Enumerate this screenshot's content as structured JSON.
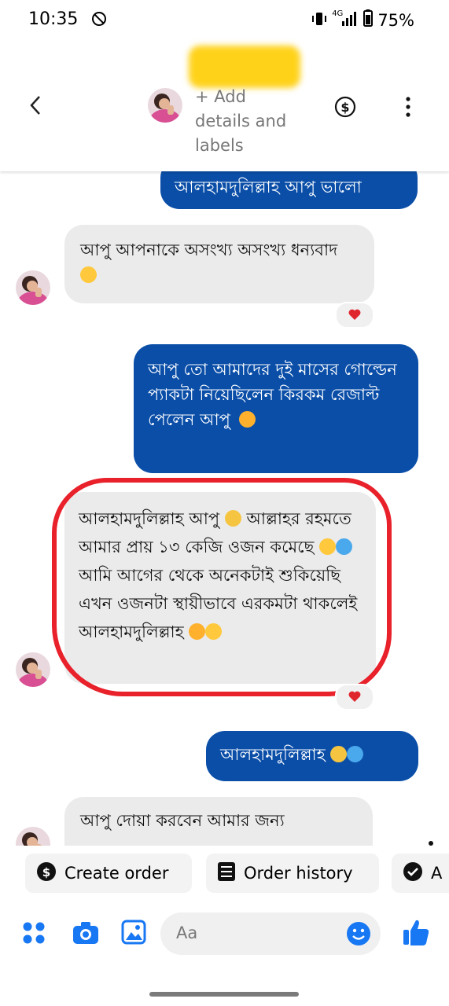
{
  "status_bar": {
    "time": "10:35",
    "network": "4G",
    "battery": "75%"
  },
  "header": {
    "details_text": "+ Add\ndetails and\nlabels",
    "icons": [
      "back-arrow-icon",
      "dollar-icon",
      "more-vert-icon"
    ]
  },
  "messages": [
    {
      "side": "out",
      "text": "আলহামদুলিল্লাহ আপু ভালো"
    },
    {
      "side": "in",
      "text": "আপু আপনাকে অসংখ্য অসংখ্য ধন্যবাদ",
      "emoji": [
        "blush"
      ],
      "reaction": "heart"
    },
    {
      "side": "out",
      "text": "আপু তো আমাদের দুই মাসের গোল্ডেন প্যাকটা নিয়েছিলেন কিরকম রেজাল্ট পেলেন আপু",
      "emoji": [
        "smiling-hearts"
      ]
    },
    {
      "side": "in",
      "text": "আলহামদুলিল্লাহ আপু",
      "text2": "আল্লাহর রহমতে আমার প্রায় ১৩ কেজি ওজন কমেছে",
      "text3": "আমি আগের থেকে অনেকটাই শুকিয়েছি এখন ওজনটা স্থায়ীভাবে এরকমটা থাকলেই আলহামদুলিল্লাহ",
      "highlighted": true,
      "reaction": "heart"
    },
    {
      "side": "out",
      "text": "আলহামদুলিল্লাহ",
      "emoji": [
        "raised-hands",
        "blue-heart"
      ]
    },
    {
      "side": "in",
      "text": "আপু দোয়া করবেন আমার জন্য"
    }
  ],
  "quick_replies": [
    "Create order",
    "Order history",
    "A"
  ],
  "composer": {
    "placeholder": "Aa"
  },
  "colors": {
    "outgoing_bubble": "#0a4ea8",
    "incoming_bubble": "#ebebeb",
    "accent": "#1877f2",
    "highlight": "#e8212b"
  }
}
